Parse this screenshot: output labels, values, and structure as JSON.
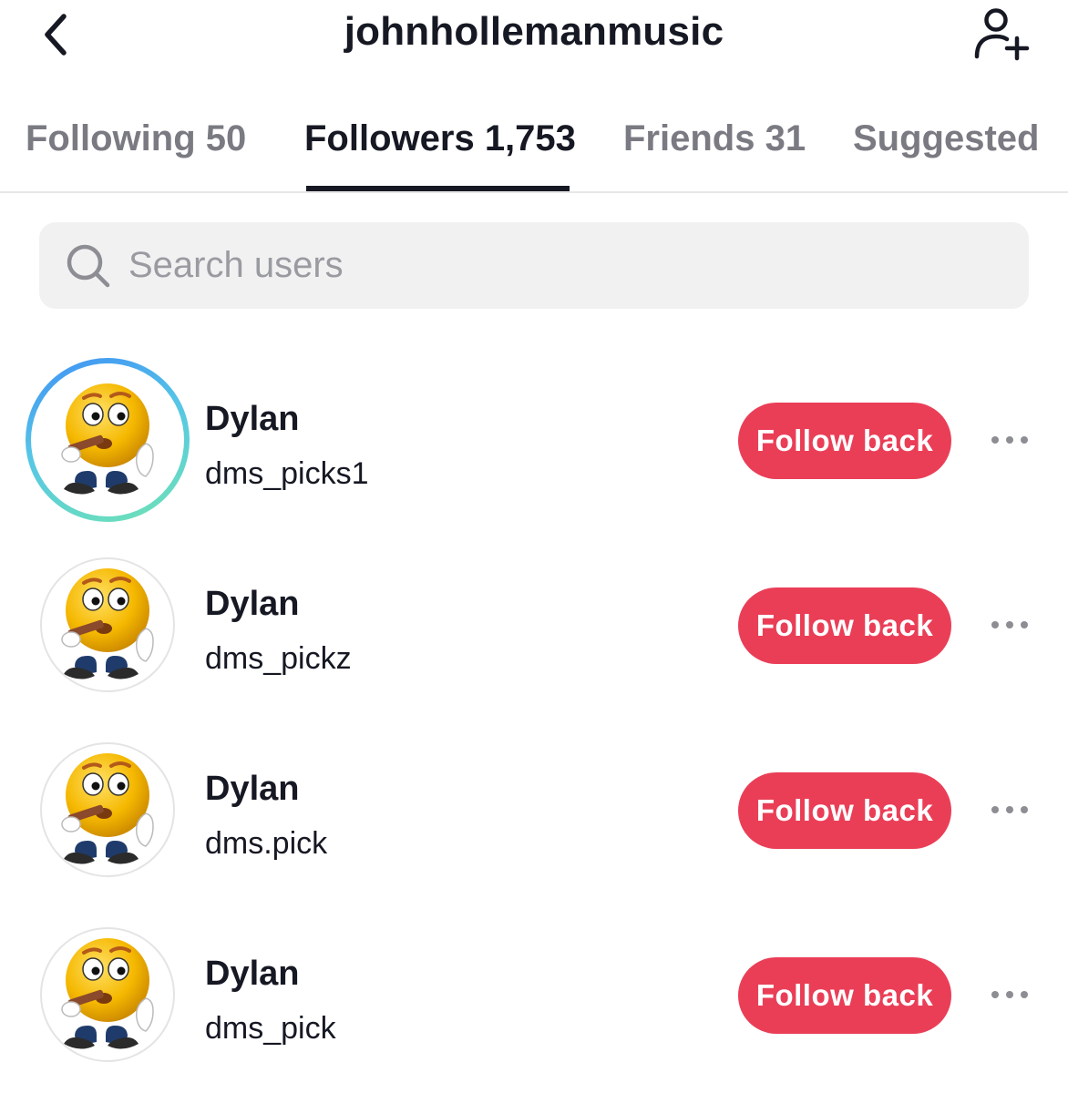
{
  "header": {
    "title": "johnhollemanmusic",
    "back_icon": "chevron-left-icon",
    "add_user_icon": "person-plus-icon"
  },
  "tabs": [
    {
      "label": "Following 50",
      "active": false
    },
    {
      "label": "Followers 1,753",
      "active": true
    },
    {
      "label": "Friends 31",
      "active": false
    },
    {
      "label": "Suggested",
      "active": false
    }
  ],
  "search": {
    "placeholder": "Search users",
    "value": ""
  },
  "followers": [
    {
      "name": "Dylan",
      "handle": "dms_picks1",
      "button": "Follow back",
      "has_story_ring": true
    },
    {
      "name": "Dylan",
      "handle": "dms_pickz",
      "button": "Follow back",
      "has_story_ring": false
    },
    {
      "name": "Dylan",
      "handle": "dms.pick",
      "button": "Follow back",
      "has_story_ring": false
    },
    {
      "name": "Dylan",
      "handle": "dms_pick",
      "button": "Follow back",
      "has_story_ring": false
    }
  ],
  "colors": {
    "accent": "#ea3e57",
    "text": "#161823",
    "muted": "#7a7b82",
    "ring_start": "#3f8ff5",
    "ring_end": "#6fe3b4"
  }
}
